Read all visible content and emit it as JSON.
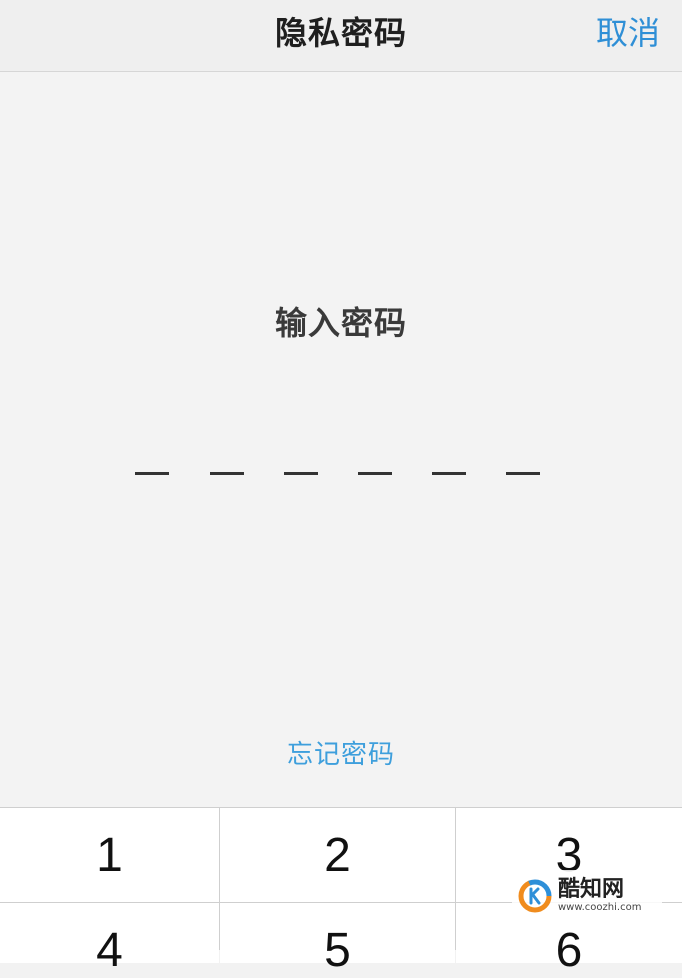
{
  "navbar": {
    "title": "隐私密码",
    "cancel_label": "取消"
  },
  "main": {
    "prompt": "输入密码",
    "pin_length": 6,
    "forgot_label": "忘记密码"
  },
  "keypad": {
    "keys": [
      "1",
      "2",
      "3",
      "4",
      "5",
      "6"
    ]
  },
  "watermark": {
    "name": "酷知网",
    "url": "www.coozhi.com"
  },
  "colors": {
    "accent": "#2f8fd6",
    "link": "#3e9fdc",
    "background": "#f3f3f3"
  }
}
